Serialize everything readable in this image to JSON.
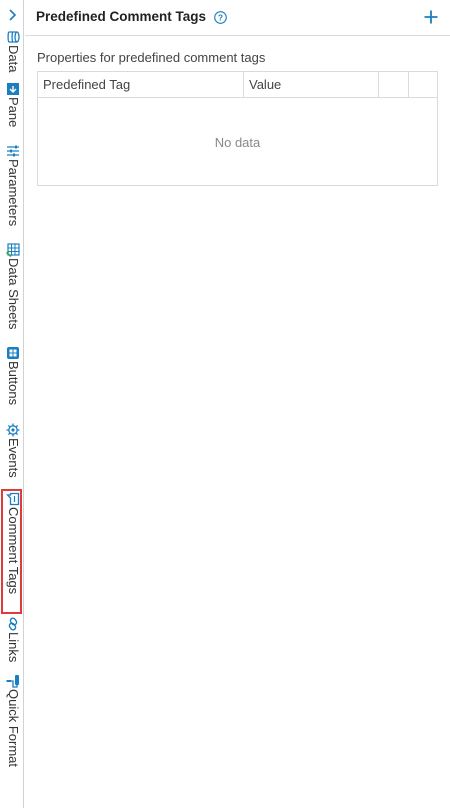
{
  "sidebar": {
    "tabs": [
      {
        "label": "Data",
        "icon": "database-icon"
      },
      {
        "label": "Pane",
        "icon": "pane-icon"
      },
      {
        "label": "Parameters",
        "icon": "parameters-icon"
      },
      {
        "label": "Data Sheets",
        "icon": "data-sheets-icon"
      },
      {
        "label": "Buttons",
        "icon": "buttons-icon"
      },
      {
        "label": "Events",
        "icon": "events-gear-icon"
      },
      {
        "label": "Comment Tags",
        "icon": "comment-tags-icon",
        "active": true
      },
      {
        "label": "Links",
        "icon": "link-icon"
      },
      {
        "label": "Quick Format",
        "icon": "paint-roller-icon"
      }
    ]
  },
  "panel": {
    "title": "Predefined Comment Tags",
    "subtitle": "Properties for predefined comment tags",
    "table": {
      "columns": [
        "Predefined Tag",
        "Value",
        "",
        ""
      ],
      "empty_text": "No data"
    }
  },
  "colors": {
    "accent": "#1a7fc1",
    "active_outline": "#e03a3a",
    "border": "#d6dbe0"
  }
}
